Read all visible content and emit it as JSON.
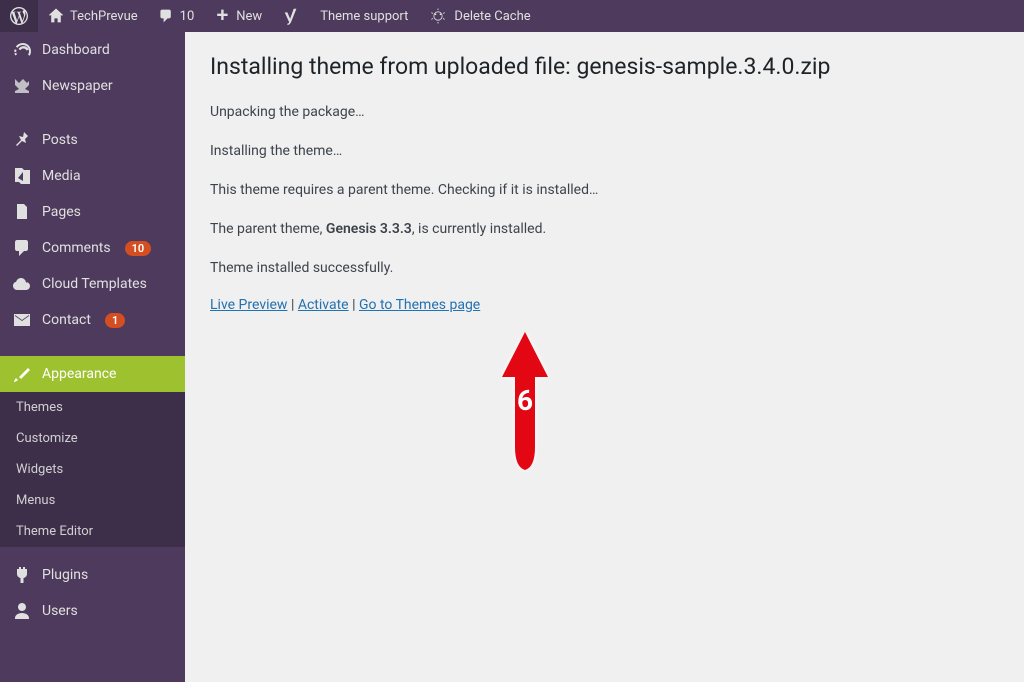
{
  "topbar": {
    "site_name": "TechPrevue",
    "comments_count": "10",
    "new_label": "New",
    "yoast_label": "",
    "theme_support": "Theme support",
    "delete_cache": "Delete Cache"
  },
  "sidebar": {
    "dashboard": "Dashboard",
    "newspaper": "Newspaper",
    "posts": "Posts",
    "media": "Media",
    "pages": "Pages",
    "comments": "Comments",
    "comments_badge": "10",
    "cloud_templates": "Cloud Templates",
    "contact": "Contact",
    "contact_badge": "1",
    "appearance": "Appearance",
    "sub": {
      "themes": "Themes",
      "customize": "Customize",
      "widgets": "Widgets",
      "menus": "Menus",
      "theme_editor": "Theme Editor"
    },
    "plugins": "Plugins",
    "users": "Users"
  },
  "main": {
    "title": "Installing theme from uploaded file: genesis-sample.3.4.0.zip",
    "line1": "Unpacking the package…",
    "line2": "Installing the theme…",
    "line3": "This theme requires a parent theme. Checking if it is installed…",
    "line4_prefix": "The parent theme, ",
    "line4_strong": "Genesis 3.3.3",
    "line4_suffix": ", is currently installed.",
    "line5": "Theme installed successfully.",
    "link_preview": "Live Preview",
    "link_activate": "Activate",
    "link_themes": "Go to Themes page"
  },
  "annotation": {
    "number": "6"
  }
}
